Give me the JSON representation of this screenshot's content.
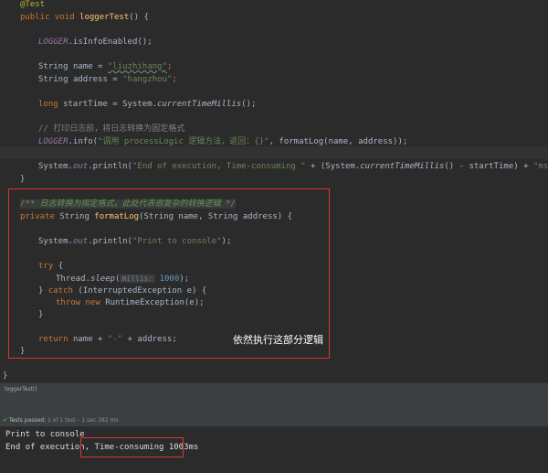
{
  "editor": {
    "l_annotation": "@Test",
    "l_test_mod": "public void ",
    "l_test_name": "loggerTest",
    "l_test_rest": "() {",
    "l_logger_1": "LOGGER",
    "l_isinfo": ".isInfoEnabled();",
    "l_type_string": "String ",
    "l_name_eq": "name = ",
    "l_name_val": "\"liuzhihang\"",
    "l_semicolon": ";",
    "l_addr_eq": "address = ",
    "l_addr_val": "\"hangzhou\"",
    "l_long": "long ",
    "l_start": "startTime = System.",
    "l_ctm": "currentTimeMillis",
    "l_paren_semi": "();",
    "l_comment": "// 打印日志前，将日志转换为固定格式",
    "l_logger_2": "LOGGER",
    "l_info": ".info(",
    "l_info_str": "\"调用 processLogic 逻辑方法，返回：{}\"",
    "l_info_rest": ", formatLog(name, address));",
    "l_sys": "System.",
    "l_out": "out",
    "l_println": ".println(",
    "l_end_str": "\"End of execution, Time-consuming \"",
    "l_end_mid": " + (System.",
    "l_end_tail": "() - startTime) + ",
    "l_ms_str": "\"ms\"",
    "l_close_paren": ");",
    "l_brace_close": "}",
    "l_doc": "/** 日志转换为指定格式，此处代表很复杂的转换逻辑 */",
    "l_private": "private ",
    "l_fmt_ret": "String ",
    "l_fmt_name": "formatLog",
    "l_fmt_params": "(String name, String address) {",
    "l_print_str": "\"Print to console\"",
    "l_try": "try ",
    "l_open_brace": "{",
    "l_thread": "Thread.",
    "l_sleep": "sleep",
    "l_open_paren": "(",
    "l_hint": "millis:",
    "l_num": "1000",
    "l_catch_close": "} ",
    "l_catch": "catch ",
    "l_catch_rest": "(InterruptedException e) {",
    "l_throw": "throw new ",
    "l_rte": "RuntimeException(e);",
    "l_return": "return ",
    "l_ret_name": "name + ",
    "l_dash": "\"-\"",
    "l_ret_rest": " + address;",
    "annotation_text": "依然执行这部分逻辑"
  },
  "run_tab": {
    "label": "loggerTest()"
  },
  "status": {
    "check": "✔",
    "passed": "Tests passed: ",
    "count": "1",
    "detail": " of 1 test – 1 sec 282 ms"
  },
  "console": {
    "line1": "Print to console",
    "line2_prefix": "End of execution, ",
    "line2_highlight": "Time-consuming 1003ms"
  },
  "colors": {
    "highlight_box": "#d9382d",
    "background": "#2b2b2b"
  }
}
